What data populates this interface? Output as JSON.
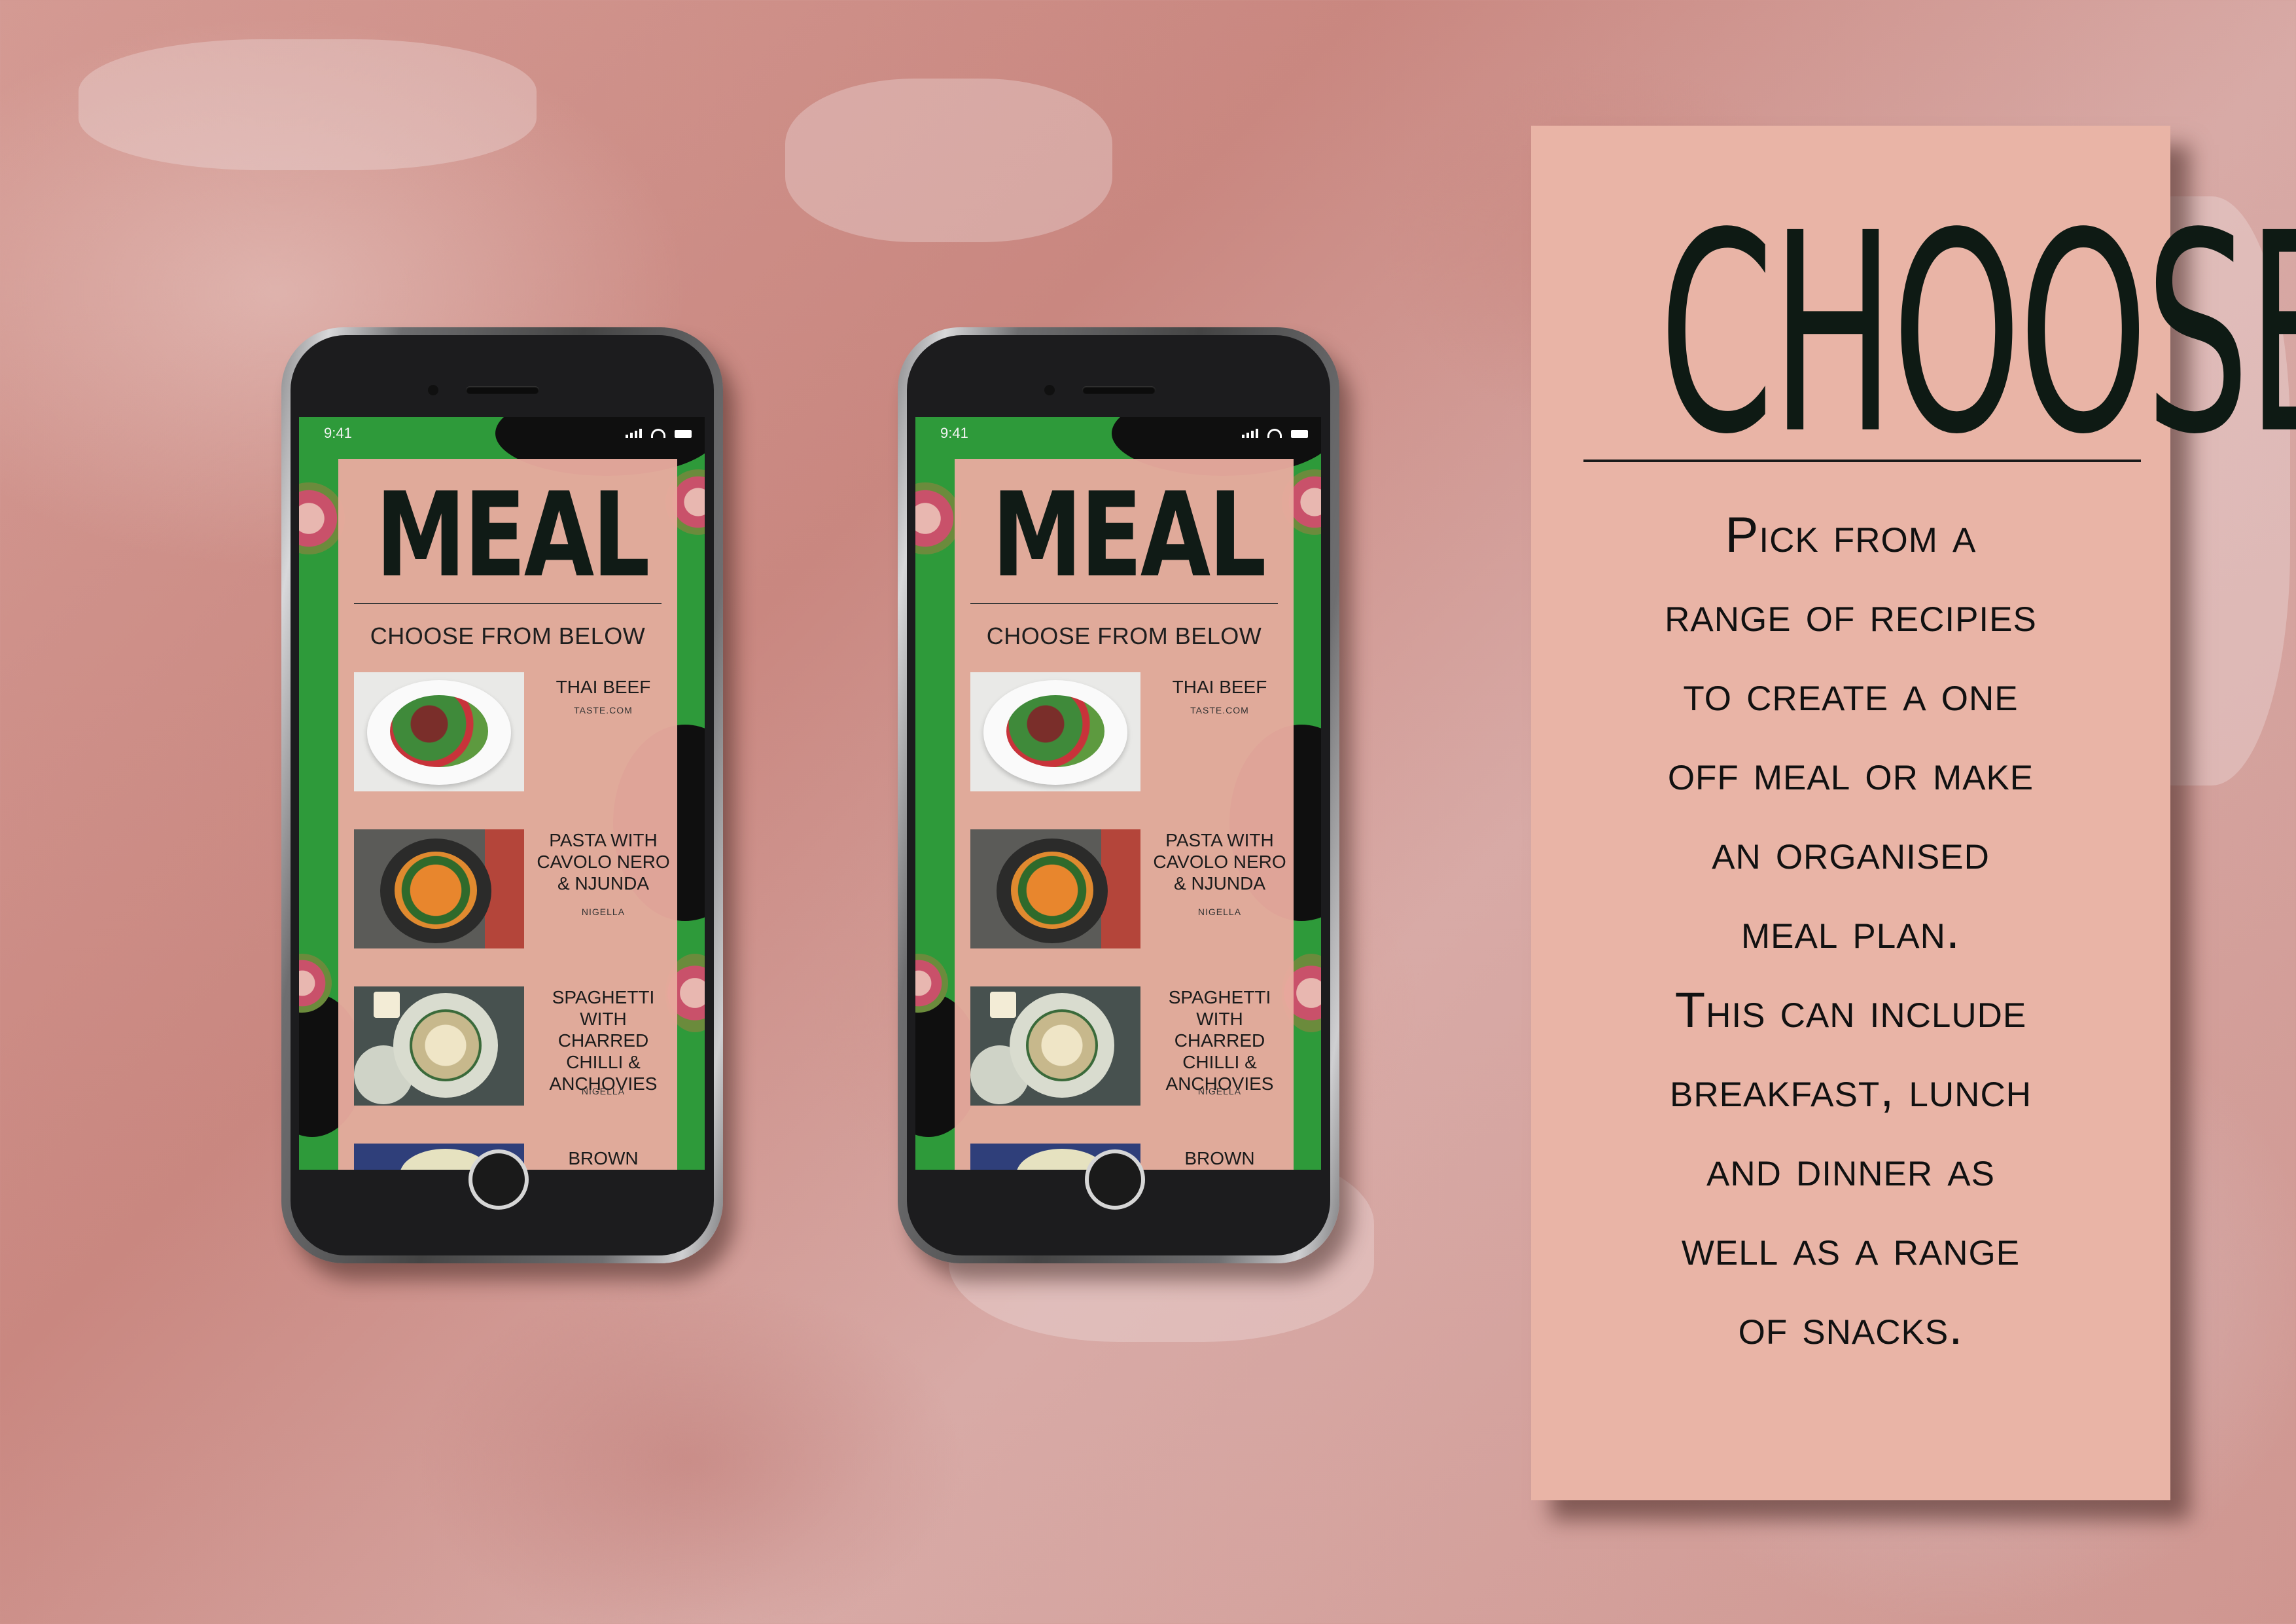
{
  "phones": [
    {
      "status_time": "9:41",
      "title": "MEAL",
      "subtitle": "CHOOSE FROM BELOW",
      "recipes": [
        {
          "name": "THAI BEEF",
          "source": "TASTE.COM"
        },
        {
          "name": "PASTA WITH CAVOLO NERO & NJUNDA",
          "source": "NIGELLA"
        },
        {
          "name": "SPAGHETTI WITH CHARRED CHILLI & ANCHOVIES",
          "source": "NIGELLA"
        },
        {
          "name": "BROWN",
          "source": ""
        }
      ]
    },
    {
      "status_time": "9:41",
      "title": "MEAL",
      "subtitle": "CHOOSE FROM BELOW",
      "recipes": [
        {
          "name": "THAI BEEF",
          "source": "TASTE.COM"
        },
        {
          "name": "PASTA WITH CAVOLO NERO & NJUNDA",
          "source": "NIGELLA"
        },
        {
          "name": "SPAGHETTI WITH CHARRED CHILLI & ANCHOVIES",
          "source": "NIGELLA"
        },
        {
          "name": "BROWN",
          "source": ""
        }
      ]
    }
  ],
  "card": {
    "title": "CHOOSE",
    "body_lines": [
      "Pick from a",
      "range of recipies",
      "to create a one",
      "off meal or make",
      "an organised",
      "meal plan.",
      "This can include",
      "breakfast, lunch",
      "and dinner as",
      "well as a range",
      "of snacks."
    ]
  },
  "colors": {
    "panel_pink": "#e8ab9e",
    "screen_green": "#2e9a3a",
    "card_pink": "#e9b4a6",
    "ink": "#101b16"
  }
}
